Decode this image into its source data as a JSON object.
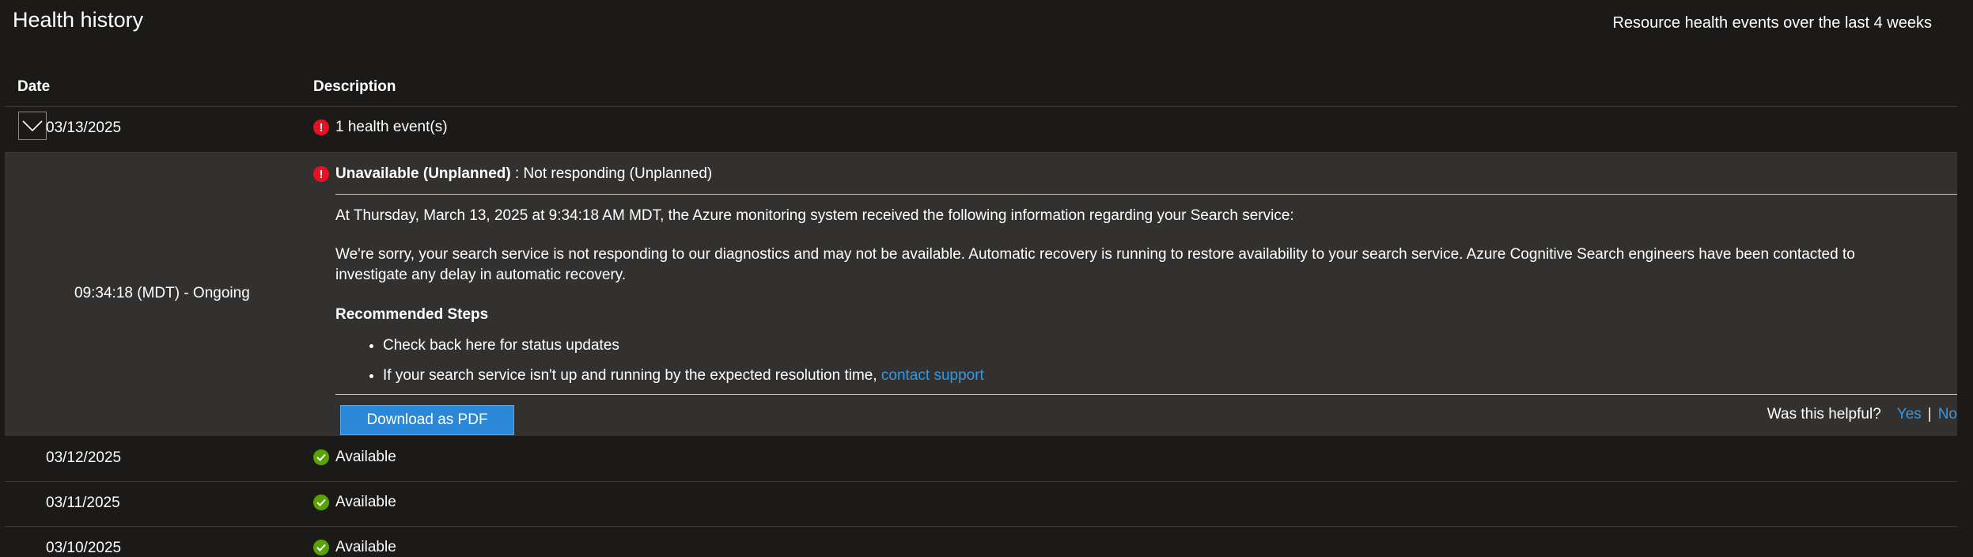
{
  "header": {
    "title": "Health history",
    "subtitle": "Resource health events over the last 4 weeks"
  },
  "table": {
    "columns": [
      "Date",
      "Description"
    ]
  },
  "expanded_row": {
    "date": "03/13/2025",
    "summary": "1 health event(s)",
    "event": {
      "time": "09:34:18 (MDT) - Ongoing",
      "status": "Unavailable (Unplanned)",
      "status_detail": " : Not responding (Unplanned)",
      "info_line": "At Thursday, March 13, 2025 at 9:34:18 AM MDT, the Azure monitoring system received the following information regarding your Search service:",
      "message": "We're sorry, your search service is not responding to our diagnostics and may not be available. Automatic recovery is running to restore availability to your search service. Azure Cognitive Search engineers have been contacted to investigate any delay in automatic recovery.",
      "steps_title": "Recommended Steps",
      "step_1": "Check back here for status updates",
      "step_2_text": "If your search service isn't up and running by the expected resolution time, ",
      "step_2_link": "contact support",
      "download_label": "Download as PDF",
      "helpful_question": "Was this helpful?",
      "helpful_yes": "Yes",
      "helpful_sep": "|",
      "helpful_no": "No"
    }
  },
  "rows": [
    {
      "date": "03/12/2025",
      "status": "Available"
    },
    {
      "date": "03/11/2025",
      "status": "Available"
    },
    {
      "date": "03/10/2025",
      "status": "Available"
    }
  ],
  "colors": {
    "background": "#1b1a19",
    "detail_background": "#323130",
    "error": "#e81123",
    "available": "#57a300",
    "link": "#3a96dd",
    "primary_button": "#2b88d8"
  },
  "icons": {
    "expand": "chevron-down-icon",
    "error": "error-circle-icon",
    "available": "check-circle-icon"
  }
}
